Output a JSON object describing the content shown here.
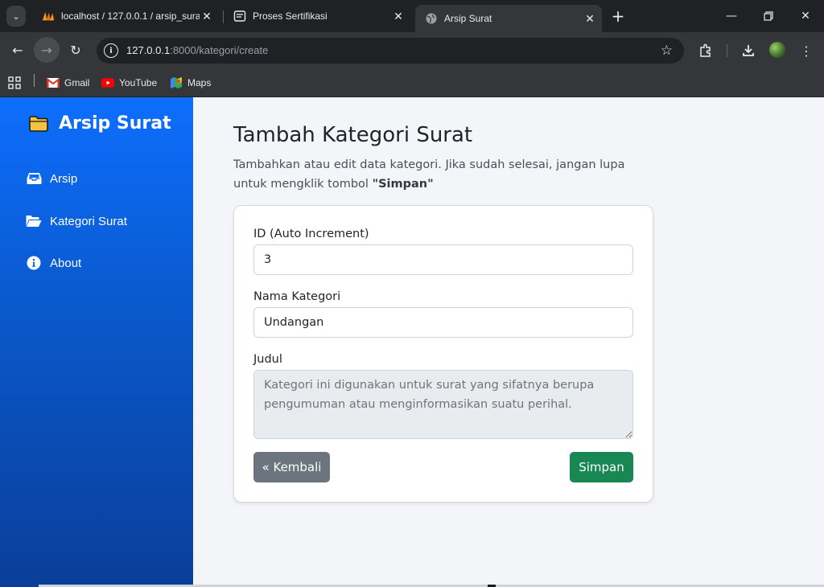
{
  "browser": {
    "tabs": [
      {
        "title": "localhost / 127.0.0.1 / arsip_surat",
        "icon": "phpmyadmin-icon"
      },
      {
        "title": "Proses Sertifikasi",
        "icon": "document-icon"
      },
      {
        "title": "Arsip Surat",
        "icon": "globe-icon",
        "active": true
      }
    ],
    "url_host": "127.0.0.1",
    "url_path": ":8000/kategori/create",
    "bookmarks": [
      {
        "label": "Gmail",
        "icon": "gmail-icon"
      },
      {
        "label": "YouTube",
        "icon": "youtube-icon"
      },
      {
        "label": "Maps",
        "icon": "maps-icon"
      }
    ]
  },
  "sidebar": {
    "brand": "Arsip Surat",
    "items": [
      {
        "label": "Arsip",
        "icon": "inbox-icon"
      },
      {
        "label": "Kategori Surat",
        "icon": "folder-open-icon"
      },
      {
        "label": "About",
        "icon": "info-icon"
      }
    ]
  },
  "main": {
    "title": "Tambah Kategori Surat",
    "desc_prefix": "Tambahkan atau edit data kategori. Jika sudah selesai, jangan lupa untuk mengklik tombol ",
    "desc_bold": "\"Simpan\"",
    "form": {
      "id_label": "ID (Auto Increment)",
      "id_value": "3",
      "nama_label": "Nama Kategori",
      "nama_value": "Undangan",
      "judul_label": "Judul",
      "judul_value": "Kategori ini digunakan untuk surat yang sifatnya berupa pengumuman atau menginformasikan suatu perihal."
    },
    "buttons": {
      "back": "« Kembali",
      "save": "Simpan"
    }
  },
  "colors": {
    "sidebar_top": "#0d6efd",
    "sidebar_bottom": "#0a3e9a",
    "save_button": "#198754",
    "back_button": "#6c757d",
    "page_bg": "#f3f5f9"
  }
}
